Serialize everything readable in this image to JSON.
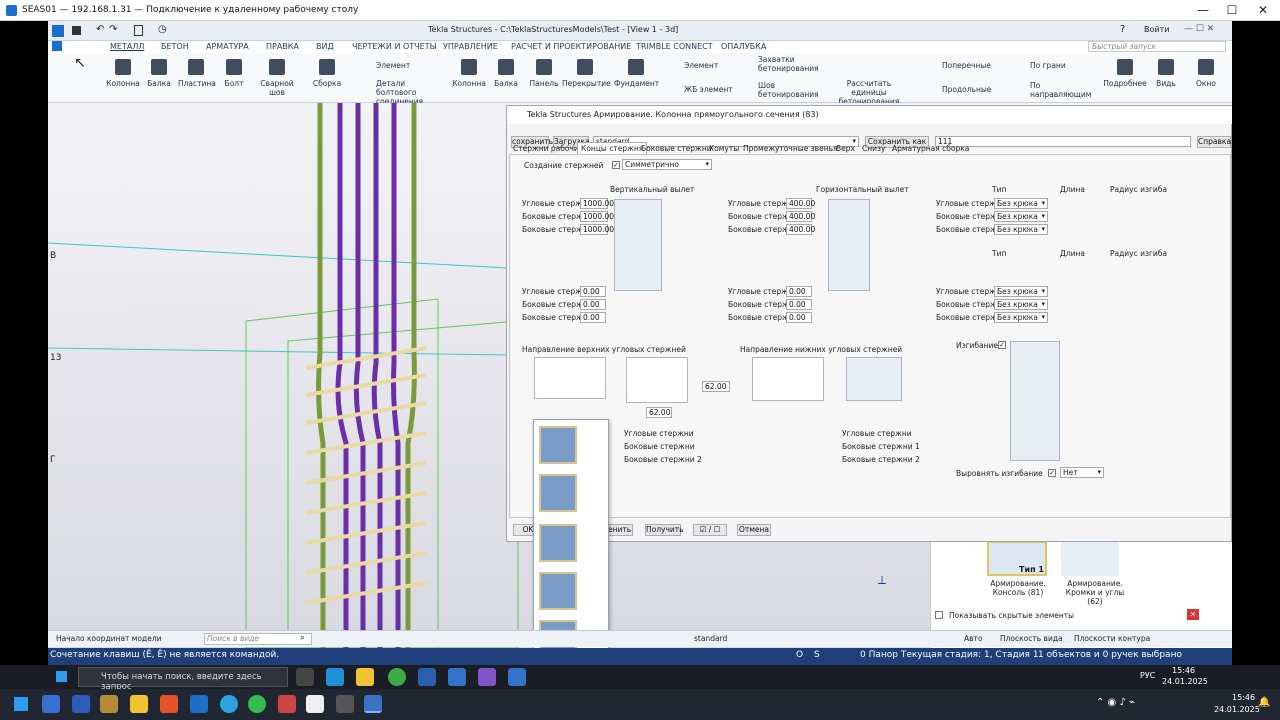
{
  "rdp": {
    "title": "SEAS01 — 192.168.1.31 — Подключение к удаленному рабочему столу",
    "min": "—",
    "max": "☐",
    "close": "✕"
  },
  "app": {
    "title": "Tekla Structures - C:\\TeklaStructuresModels\\Test - [View 1 - 3d]",
    "login": "Войти",
    "search_placeholder": "Быстрый запуск",
    "menu": [
      "МЕТАЛЛ",
      "БЕТОН",
      "АРМАТУРА",
      "ПРАВКА",
      "ВИД",
      "ЧЕРТЕЖИ И ОТЧЕТЫ",
      "УПРАВЛЕНИЕ",
      "РАСЧЕТ И ПРОЕКТИРОВАНИЕ",
      "TRIMBLE CONNECT",
      "ОПАЛУБКА"
    ],
    "ribbon": [
      "Колонна",
      "Балка",
      "Пластина",
      "Болт",
      "Сварной шов",
      "Сборка",
      "Элемент",
      "Детали болтового соединения",
      "Колонна",
      "Балка",
      "Панель",
      "Перекрытие",
      "Фундамент",
      "Элемент",
      "ЖБ элемент",
      "Захватки бетонирования",
      "Шов бетонирования",
      "Рассчитать единицы бетонирования",
      "Поперечные",
      "Продольные",
      "По грани",
      "По направляющим",
      "Подробнее",
      "Видь",
      "Окно"
    ]
  },
  "view": {
    "grid_labels": [
      "В",
      "13",
      "Г"
    ],
    "tile_caption_1": "Тип 1",
    "tile_label_1": "Армирование. Консоль (81)",
    "tile_label_2": "Армирование. Кромки и углы (62)",
    "show_hidden": "Показывать скрытые элементы"
  },
  "dialog": {
    "title": "Tekla Structures  Армирование. Колонна прямоугольного сечения (83)",
    "save_btn": "сохранить",
    "load_btn": "Загрузка",
    "preset": "standard",
    "save_as_btn": "Сохранить как",
    "save_as_value": "111",
    "help_btn": "Справка...",
    "tabs": [
      "Стержни рабочие",
      "Концы стержня",
      "Боковые стержни",
      "Хомуты",
      "Промежуточные звенья",
      "Верх",
      "Снизу",
      "Арматурная сборка"
    ],
    "active_tab": 1,
    "create_rods_label": "Создание стержней",
    "create_rods_value": "Симметрично",
    "vert_overhang": "Вертикальный вылет",
    "horiz_overhang": "Горизонтальный вылет",
    "type_hdr": "Тип",
    "length_hdr": "Длина",
    "radius_hdr": "Радиус изгиба",
    "top_rows": [
      {
        "label": "Угловые стерж",
        "v": "1000.00",
        "h": "400.00",
        "type": "Без крюка"
      },
      {
        "label": "Боковые стерж",
        "v": "1000.00",
        "h": "400.00",
        "type": "Без крюка"
      },
      {
        "label": "Боковые стерж",
        "v": "1000.00",
        "h": "400.00",
        "type": "Без крюка"
      }
    ],
    "bot_rows": [
      {
        "label": "Угловые стерж",
        "v": "0.00",
        "h": "0.00",
        "type": "Без крюка"
      },
      {
        "label": "Боковые стерж",
        "v": "0.00",
        "h": "0.00",
        "type": "Без крюка"
      },
      {
        "label": "Боковые стерж",
        "v": "0.00",
        "h": "0.00",
        "type": "Без крюка"
      }
    ],
    "dir_top": "Направление верхних угловых стержней",
    "dir_bottom": "Направление нижних угловых стержней",
    "bending": "Изгибание",
    "val_62a": "62.00",
    "val_62b": "62.00",
    "lower_left": [
      "Угловые стержни",
      "Боковые стержни",
      "Боковые стержни 2"
    ],
    "lower_right": [
      "Угловые стержни",
      "Боковые стержни 1",
      "Боковые стержни 2"
    ],
    "align_bending": "Выровнять изгибание",
    "align_value": "Нет",
    "ok": "OK",
    "apply": "Изменить",
    "get": "Получить",
    "toggle": "☑ / ☐",
    "cancel": "Отмена"
  },
  "status": {
    "origin": "Начало координат модели",
    "search": "Поиск в виде",
    "standard": "standard",
    "auto": "Авто",
    "view_plane": "Плоскость вида",
    "contour_planes": "Плоскости контура",
    "command": "Сочетание клавиш (Ê, Ê) не является командой.",
    "o": "O",
    "s": "S",
    "phase": "0  Панор Текущая стадия: 1, Стадия 1",
    "selected": "1 объектов и 0 ручек выбрано"
  },
  "inner_taskbar": {
    "search": "Чтобы начать поиск, введите здесь запрос",
    "lang": "РУС",
    "time": "15:46",
    "date": "24.01.2025"
  },
  "outer_taskbar": {
    "time": "15:46",
    "date": "24.01.2025"
  }
}
